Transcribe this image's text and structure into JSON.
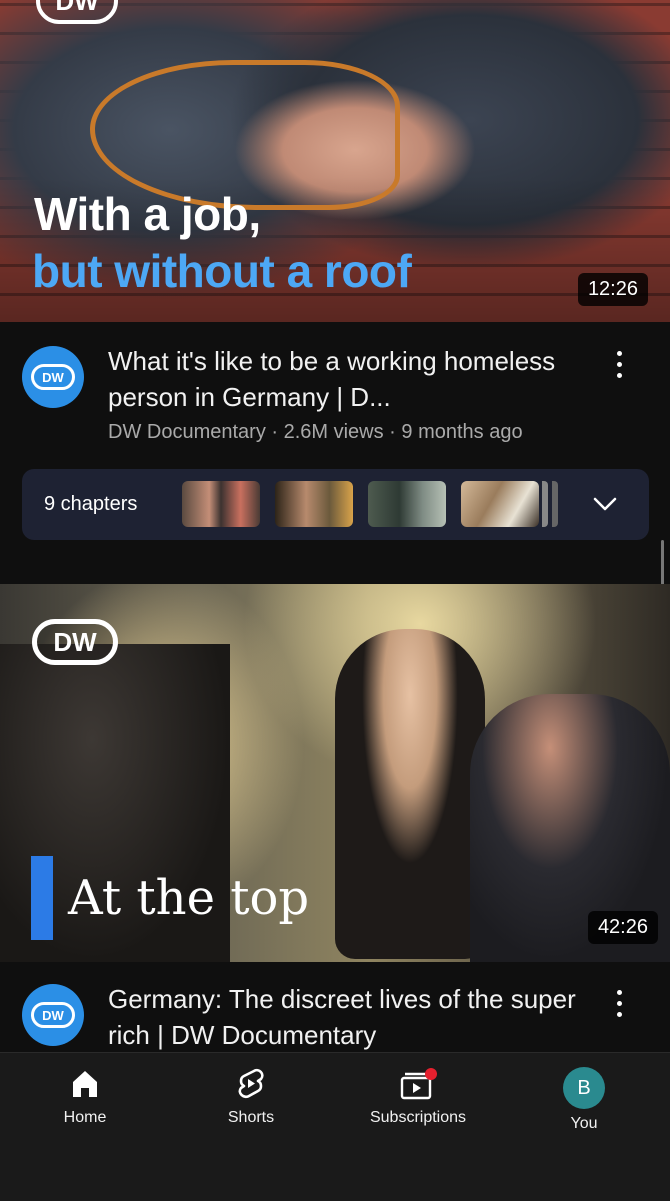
{
  "video1": {
    "thumbnail_text_line1": "With a job,",
    "thumbnail_text_line2": "but without a roof",
    "duration": "12:26",
    "channel_logo_text": "DW",
    "title": "What it's like to be a working homeless person in Germany | D...",
    "meta": "DW Documentary · 2.6M views · 9 months ago",
    "chapters_label": "9 chapters"
  },
  "video2": {
    "thumbnail_logo_text": "DW",
    "thumbnail_title": "At the top",
    "duration": "42:26",
    "channel_logo_text": "DW",
    "title": "Germany: The discreet lives of the super rich | DW Documentary"
  },
  "nav": {
    "home": "Home",
    "shorts": "Shorts",
    "subscriptions": "Subscriptions",
    "you": "You",
    "you_initial": "B"
  },
  "colors": {
    "accent_blue": "#4da8f5",
    "dw_blue": "#2b8fe6",
    "notification_dot": "#e5202e"
  },
  "icons": [
    "home-icon",
    "shorts-icon",
    "subscriptions-icon",
    "more-vertical-icon",
    "chevron-down-icon"
  ]
}
